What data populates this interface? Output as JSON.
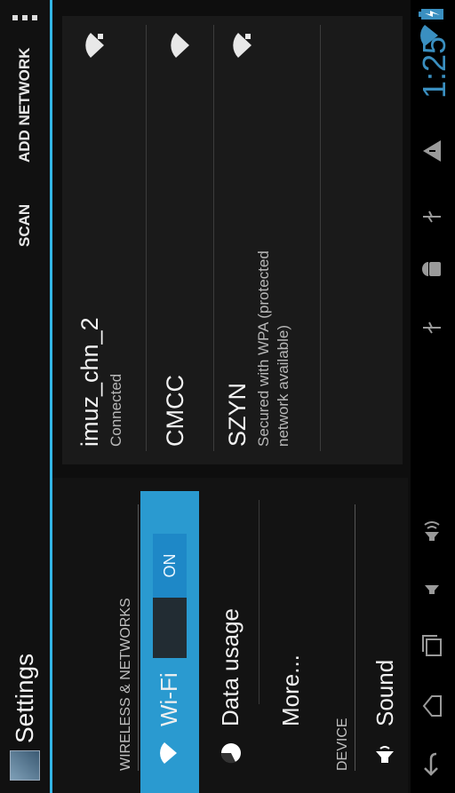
{
  "action_bar": {
    "title": "Settings",
    "scan_label": "SCAN",
    "add_network_label": "ADD NETWORK"
  },
  "sidebar": {
    "section_wireless": "WIRELESS & NETWORKS",
    "wifi_label": "Wi-Fi",
    "wifi_switch": "ON",
    "data_usage_label": "Data usage",
    "more_label": "More...",
    "section_device": "DEVICE",
    "sound_label": "Sound"
  },
  "networks": [
    {
      "name": "imuz_chn_2",
      "status": "Connected"
    },
    {
      "name": "CMCC",
      "status": ""
    },
    {
      "name": "SZYN",
      "status": "Secured with WPA (protected network available)"
    }
  ],
  "status_bar": {
    "time": "1:25"
  },
  "colors": {
    "accent": "#33b5e5",
    "wifi_row": "#2a9ad0"
  }
}
